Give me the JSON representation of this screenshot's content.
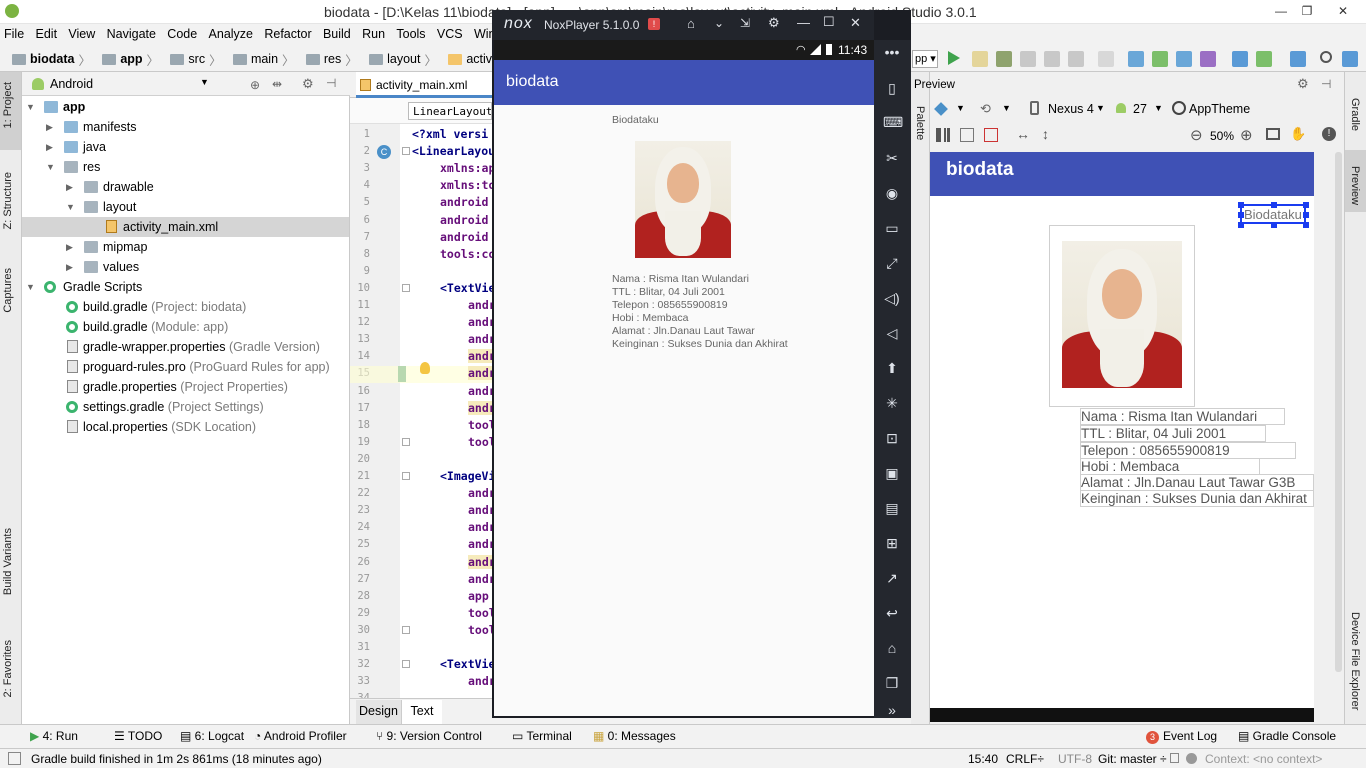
{
  "window": {
    "title": "biodata - [D:\\Kelas 11\\biodata] - [app] - ...\\app\\src\\main\\res\\layout\\activity_main.xml - Android Studio 3.0.1"
  },
  "menu": [
    "File",
    "Edit",
    "View",
    "Navigate",
    "Code",
    "Analyze",
    "Refactor",
    "Build",
    "Run",
    "Tools",
    "VCS",
    "Window"
  ],
  "breadcrumb": [
    "biodata",
    "app",
    "src",
    "main",
    "res",
    "layout",
    "activity_main.xml"
  ],
  "left_strip": {
    "project": "1: Project",
    "structure": "Z: Structure",
    "captures": "Captures",
    "build_variants": "Build Variants",
    "favorites": "2: Favorites"
  },
  "right_strip": {
    "gradle": "Gradle",
    "preview": "Preview",
    "device_explorer": "Device File Explorer"
  },
  "project_panel": {
    "view_mode": "Android",
    "tree": [
      {
        "label": "app",
        "note": "",
        "bold": true
      },
      {
        "label": "manifests",
        "note": ""
      },
      {
        "label": "java",
        "note": ""
      },
      {
        "label": "res",
        "note": ""
      },
      {
        "label": "drawable",
        "note": ""
      },
      {
        "label": "layout",
        "note": ""
      },
      {
        "label": "activity_main.xml",
        "note": ""
      },
      {
        "label": "mipmap",
        "note": ""
      },
      {
        "label": "values",
        "note": ""
      },
      {
        "label": "Gradle Scripts",
        "note": ""
      },
      {
        "label": "build.gradle",
        "note": "(Project: biodata)"
      },
      {
        "label": "build.gradle",
        "note": "(Module: app)"
      },
      {
        "label": "gradle-wrapper.properties",
        "note": "(Gradle Version)"
      },
      {
        "label": "proguard-rules.pro",
        "note": "(ProGuard Rules for app)"
      },
      {
        "label": "gradle.properties",
        "note": "(Project Properties)"
      },
      {
        "label": "settings.gradle",
        "note": "(Project Settings)"
      },
      {
        "label": "local.properties",
        "note": "(SDK Location)"
      }
    ]
  },
  "editor": {
    "tab": "activity_main.xml",
    "crumb": "LinearLayout",
    "mode_tabs": [
      "Design",
      "Text"
    ],
    "lines": [
      {
        "n": "1",
        "t": "<?xml versi"
      },
      {
        "n": "2",
        "t": "<LinearLayou"
      },
      {
        "n": "3",
        "t": "xmlns:ap"
      },
      {
        "n": "4",
        "t": "xmlns:to"
      },
      {
        "n": "5",
        "t": "android"
      },
      {
        "n": "6",
        "t": "android"
      },
      {
        "n": "7",
        "t": "android"
      },
      {
        "n": "8",
        "t": "tools:co"
      },
      {
        "n": "9",
        "t": ""
      },
      {
        "n": "10",
        "t": "<TextVie"
      },
      {
        "n": "11",
        "t": "andr"
      },
      {
        "n": "12",
        "t": "andr"
      },
      {
        "n": "13",
        "t": "andr"
      },
      {
        "n": "14",
        "t": "andr"
      },
      {
        "n": "15",
        "t": "andr"
      },
      {
        "n": "16",
        "t": "andr"
      },
      {
        "n": "17",
        "t": "andr"
      },
      {
        "n": "18",
        "t": "tool"
      },
      {
        "n": "19",
        "t": "tool"
      },
      {
        "n": "20",
        "t": ""
      },
      {
        "n": "21",
        "t": "<ImageVi"
      },
      {
        "n": "22",
        "t": "andr"
      },
      {
        "n": "23",
        "t": "andr"
      },
      {
        "n": "24",
        "t": "andr"
      },
      {
        "n": "25",
        "t": "andr"
      },
      {
        "n": "26",
        "t": "andr"
      },
      {
        "n": "27",
        "t": "andr"
      },
      {
        "n": "28",
        "t": "app"
      },
      {
        "n": "29",
        "t": "tool"
      },
      {
        "n": "30",
        "t": "tool"
      },
      {
        "n": "31",
        "t": ""
      },
      {
        "n": "32",
        "t": "<TextVie"
      },
      {
        "n": "33",
        "t": "andr"
      },
      {
        "n": "34",
        "t": "andr"
      }
    ]
  },
  "nox": {
    "title": "NoxPlayer 5.1.0.0",
    "time": "11:43",
    "app_title": "biodata",
    "heading": "Biodataku",
    "info": [
      "Nama      : Risma Itan Wulandari",
      "TTL         : Blitar, 04 Juli 2001",
      "Telepon    : 085655900819",
      "Hobi        : Membaca",
      "Alamat     : Jln.Danau Laut Tawar",
      "Keinginan  : Sukses Dunia dan Akhirat"
    ]
  },
  "preview": {
    "label": "Preview",
    "palette": "Palette",
    "device": "Nexus 4",
    "api": "27",
    "theme": "AppTheme",
    "zoom": "50%",
    "app_title": "biodata",
    "heading": "Biodataku",
    "info": [
      "Nama      : Risma Itan Wulandari",
      "TTL         : Blitar, 04 Juli 2001",
      "Telepon   : 085655900819",
      "Hobi        : Membaca",
      "Alamat     : Jln.Danau Laut Tawar G3B",
      "Keinginan  : Sukses Dunia dan Akhirat"
    ]
  },
  "bottom_tabs": [
    "4: Run",
    "TODO",
    "6: Logcat",
    "Android Profiler",
    "9: Version Control",
    "Terminal",
    "0: Messages",
    "Event Log",
    "Gradle Console"
  ],
  "event_badge": "3",
  "status": {
    "message": "Gradle build finished in 1m 2s 861ms (18 minutes ago)",
    "position": "15:40",
    "line_sep": "CRLF÷",
    "encoding": "UTF-8",
    "git": "Git: master ÷",
    "context": "Context: <no context>"
  }
}
